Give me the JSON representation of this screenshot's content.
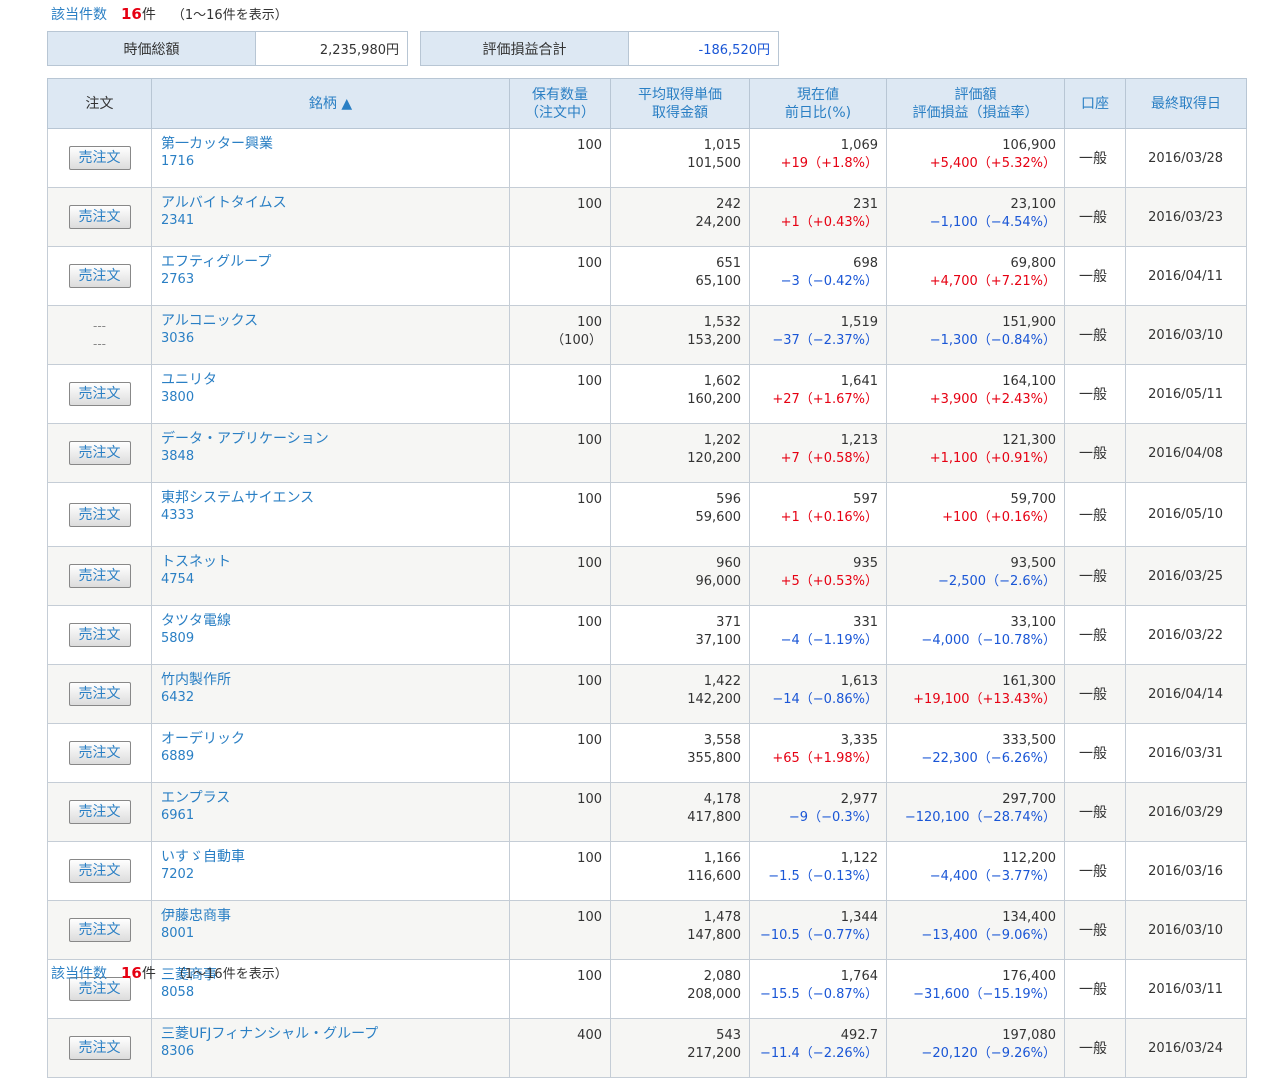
{
  "summary": {
    "count_label": "該当件数",
    "count_value": "16",
    "count_unit": "件",
    "count_range": "（1～16件を表示）",
    "market_value_label": "時価総額",
    "market_value": "2,235,980円",
    "pl_label": "評価損益合計",
    "pl_value": "-186,520円"
  },
  "headers": {
    "order": "注文",
    "name": "銘柄 ▲",
    "qty1": "保有数量",
    "qty2": "（注文中）",
    "avg1": "平均取得単価",
    "avg2": "取得金額",
    "price1": "現在値",
    "price2": "前日比(%)",
    "val1": "評価額",
    "val2": "評価損益（損益率）",
    "account": "口座",
    "date": "最終取得日"
  },
  "sell_label": "売注文",
  "dash": "---",
  "rows": [
    {
      "name": "第一カッター興業",
      "code": "1716",
      "qty": "100",
      "qty_pending": "",
      "avg": "1,015",
      "cost": "101,500",
      "price": "1,069",
      "change": "+19（+1.8%）",
      "change_dir": "pos",
      "value": "106,900",
      "pl": "+5,400（+5.32%）",
      "pl_dir": "pos",
      "account": "一般",
      "date": "2016/03/28",
      "sellable": true
    },
    {
      "name": "アルバイトタイムス",
      "code": "2341",
      "qty": "100",
      "qty_pending": "",
      "avg": "242",
      "cost": "24,200",
      "price": "231",
      "change": "+1（+0.43%）",
      "change_dir": "pos",
      "value": "23,100",
      "pl": "−1,100（−4.54%）",
      "pl_dir": "neg",
      "account": "一般",
      "date": "2016/03/23",
      "sellable": true
    },
    {
      "name": "エフティグループ",
      "code": "2763",
      "qty": "100",
      "qty_pending": "",
      "avg": "651",
      "cost": "65,100",
      "price": "698",
      "change": "−3（−0.42%）",
      "change_dir": "neg",
      "value": "69,800",
      "pl": "+4,700（+7.21%）",
      "pl_dir": "pos",
      "account": "一般",
      "date": "2016/04/11",
      "sellable": true
    },
    {
      "name": "アルコニックス",
      "code": "3036",
      "qty": "100",
      "qty_pending": "（100）",
      "avg": "1,532",
      "cost": "153,200",
      "price": "1,519",
      "change": "−37（−2.37%）",
      "change_dir": "neg",
      "value": "151,900",
      "pl": "−1,300（−0.84%）",
      "pl_dir": "neg",
      "account": "一般",
      "date": "2016/03/10",
      "sellable": false
    },
    {
      "name": "ユニリタ",
      "code": "3800",
      "qty": "100",
      "qty_pending": "",
      "avg": "1,602",
      "cost": "160,200",
      "price": "1,641",
      "change": "+27（+1.67%）",
      "change_dir": "pos",
      "value": "164,100",
      "pl": "+3,900（+2.43%）",
      "pl_dir": "pos",
      "account": "一般",
      "date": "2016/05/11",
      "sellable": true
    },
    {
      "name": "データ・アプリケーション",
      "code": "3848",
      "qty": "100",
      "qty_pending": "",
      "avg": "1,202",
      "cost": "120,200",
      "price": "1,213",
      "change": "+7（+0.58%）",
      "change_dir": "pos",
      "value": "121,300",
      "pl": "+1,100（+0.91%）",
      "pl_dir": "pos",
      "account": "一般",
      "date": "2016/04/08",
      "sellable": true
    },
    {
      "name": "東邦システムサイエンス",
      "code": "4333",
      "qty": "100",
      "qty_pending": "",
      "avg": "596",
      "cost": "59,600",
      "price": "597",
      "change": "+1（+0.16%）",
      "change_dir": "pos",
      "value": "59,700",
      "pl": "+100（+0.16%）",
      "pl_dir": "pos",
      "account": "一般",
      "date": "2016/05/10",
      "sellable": true
    },
    {
      "name": "トスネット",
      "code": "4754",
      "qty": "100",
      "qty_pending": "",
      "avg": "960",
      "cost": "96,000",
      "price": "935",
      "change": "+5（+0.53%）",
      "change_dir": "pos",
      "value": "93,500",
      "pl": "−2,500（−2.6%）",
      "pl_dir": "neg",
      "account": "一般",
      "date": "2016/03/25",
      "sellable": true
    },
    {
      "name": "タツタ電線",
      "code": "5809",
      "qty": "100",
      "qty_pending": "",
      "avg": "371",
      "cost": "37,100",
      "price": "331",
      "change": "−4（−1.19%）",
      "change_dir": "neg",
      "value": "33,100",
      "pl": "−4,000（−10.78%）",
      "pl_dir": "neg",
      "account": "一般",
      "date": "2016/03/22",
      "sellable": true
    },
    {
      "name": "竹内製作所",
      "code": "6432",
      "qty": "100",
      "qty_pending": "",
      "avg": "1,422",
      "cost": "142,200",
      "price": "1,613",
      "change": "−14（−0.86%）",
      "change_dir": "neg",
      "value": "161,300",
      "pl": "+19,100（+13.43%）",
      "pl_dir": "pos",
      "account": "一般",
      "date": "2016/04/14",
      "sellable": true
    },
    {
      "name": "オーデリック",
      "code": "6889",
      "qty": "100",
      "qty_pending": "",
      "avg": "3,558",
      "cost": "355,800",
      "price": "3,335",
      "change": "+65（+1.98%）",
      "change_dir": "pos",
      "value": "333,500",
      "pl": "−22,300（−6.26%）",
      "pl_dir": "neg",
      "account": "一般",
      "date": "2016/03/31",
      "sellable": true
    },
    {
      "name": "エンプラス",
      "code": "6961",
      "qty": "100",
      "qty_pending": "",
      "avg": "4,178",
      "cost": "417,800",
      "price": "2,977",
      "change": "−9（−0.3%）",
      "change_dir": "neg",
      "value": "297,700",
      "pl": "−120,100（−28.74%）",
      "pl_dir": "neg",
      "account": "一般",
      "date": "2016/03/29",
      "sellable": true
    },
    {
      "name": "いすゞ自動車",
      "code": "7202",
      "qty": "100",
      "qty_pending": "",
      "avg": "1,166",
      "cost": "116,600",
      "price": "1,122",
      "change": "−1.5（−0.13%）",
      "change_dir": "neg",
      "value": "112,200",
      "pl": "−4,400（−3.77%）",
      "pl_dir": "neg",
      "account": "一般",
      "date": "2016/03/16",
      "sellable": true
    },
    {
      "name": "伊藤忠商事",
      "code": "8001",
      "qty": "100",
      "qty_pending": "",
      "avg": "1,478",
      "cost": "147,800",
      "price": "1,344",
      "change": "−10.5（−0.77%）",
      "change_dir": "neg",
      "value": "134,400",
      "pl": "−13,400（−9.06%）",
      "pl_dir": "neg",
      "account": "一般",
      "date": "2016/03/10",
      "sellable": true
    },
    {
      "name": "三菱商事",
      "code": "8058",
      "qty": "100",
      "qty_pending": "",
      "avg": "2,080",
      "cost": "208,000",
      "price": "1,764",
      "change": "−15.5（−0.87%）",
      "change_dir": "neg",
      "value": "176,400",
      "pl": "−31,600（−15.19%）",
      "pl_dir": "neg",
      "account": "一般",
      "date": "2016/03/11",
      "sellable": true
    },
    {
      "name": "三菱UFJフィナンシャル・グループ",
      "code": "8306",
      "qty": "400",
      "qty_pending": "",
      "avg": "543",
      "cost": "217,200",
      "price": "492.7",
      "change": "−11.4（−2.26%）",
      "change_dir": "neg",
      "value": "197,080",
      "pl": "−20,120（−9.26%）",
      "pl_dir": "neg",
      "account": "一般",
      "date": "2016/03/24",
      "sellable": true
    }
  ]
}
